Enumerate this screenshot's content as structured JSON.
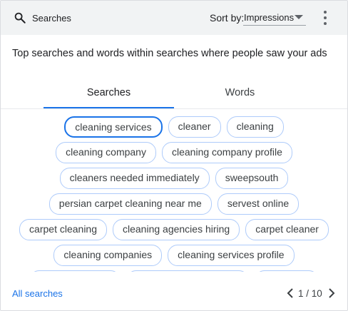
{
  "header": {
    "search_label": "Searches",
    "sort_by_label": "Sort by:",
    "sort_value": "Impressions"
  },
  "title": "Top searches and words within searches where people saw your ads",
  "tabs": [
    {
      "label": "Searches",
      "selected": true
    },
    {
      "label": "Words",
      "selected": false
    }
  ],
  "chips": [
    [
      "cleaning services",
      "cleaner",
      "cleaning"
    ],
    [
      "cleaning company",
      "cleaning company profile"
    ],
    [
      "cleaners needed immediately",
      "sweepsouth"
    ],
    [
      "persian carpet cleaning near me",
      "servest online"
    ],
    [
      "carpet cleaning",
      "cleaning agencies hiring",
      "carpet cleaner"
    ],
    [
      "cleaning companies",
      "cleaning services profile"
    ]
  ],
  "footer": {
    "all_searches_label": "All searches",
    "pagination": "1 / 10"
  }
}
